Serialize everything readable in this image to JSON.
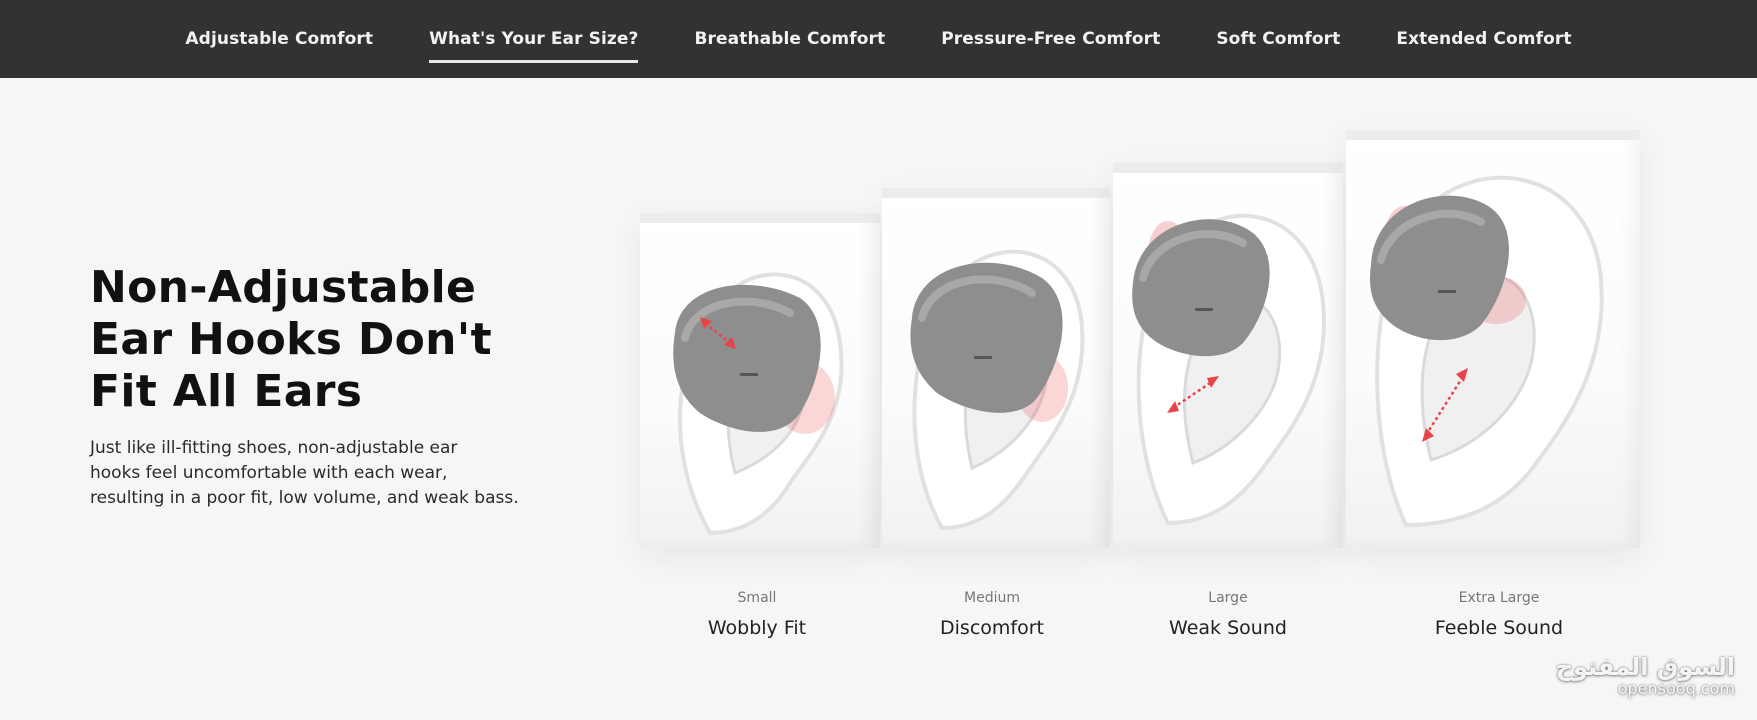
{
  "nav": {
    "tabs": [
      {
        "label": "Adjustable Comfort",
        "active": false
      },
      {
        "label": "What's Your Ear Size?",
        "active": true
      },
      {
        "label": "Breathable Comfort",
        "active": false
      },
      {
        "label": "Pressure-Free Comfort",
        "active": false
      },
      {
        "label": "Soft Comfort",
        "active": false
      },
      {
        "label": "Extended Comfort",
        "active": false
      }
    ]
  },
  "hero": {
    "headline_lines": [
      "Non-Adjustable",
      "Ear Hooks Don't",
      "Fit All Ears"
    ],
    "description_lines": [
      "Just like ill-fitting shoes, non-adjustable ear",
      "hooks feel uncomfortable with each wear,",
      "resulting in a poor fit, low volume, and weak bass."
    ]
  },
  "ear_sizes": [
    {
      "size": "Small",
      "result": "Wobbly Fit"
    },
    {
      "size": "Medium",
      "result": "Discomfort"
    },
    {
      "size": "Large",
      "result": "Weak Sound"
    },
    {
      "size": "Extra Large",
      "result": "Feeble Sound"
    }
  ],
  "watermark": {
    "arabic": "السوق المفتوح",
    "latin": "opensooq.com"
  },
  "colors": {
    "nav_background": "#323232",
    "page_background": "#f6f6f6",
    "pressure_highlight": "#e8434b",
    "earbud_gray": "#8e8e8e"
  }
}
